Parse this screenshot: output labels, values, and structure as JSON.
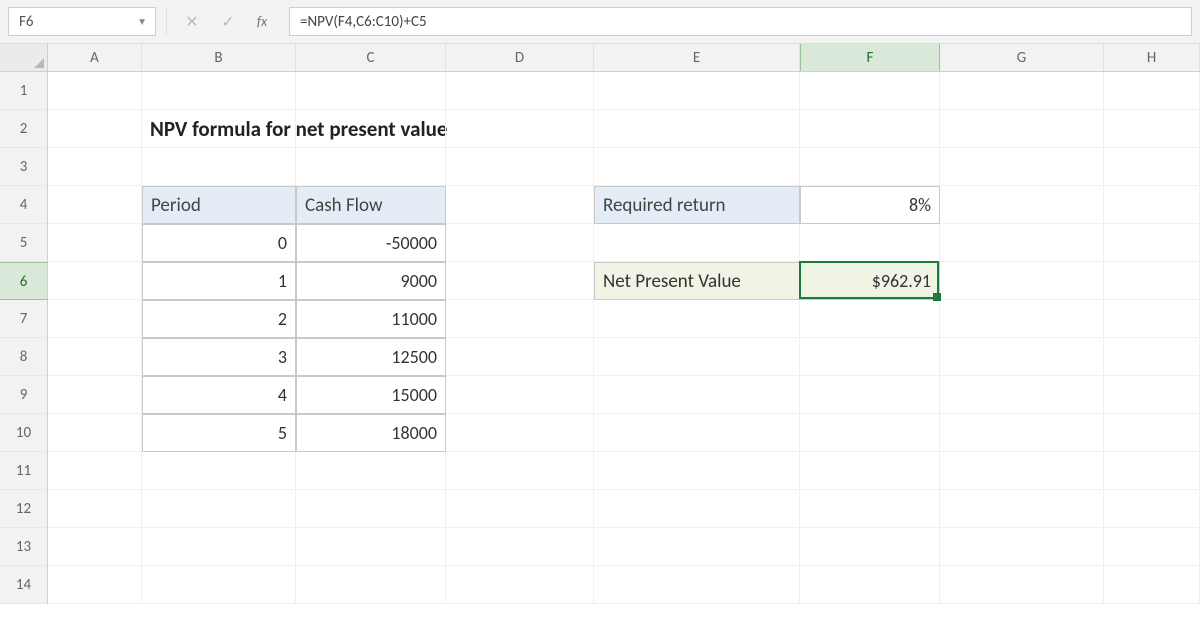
{
  "name_box": "F6",
  "formula": "=NPV(F4,C6:C10)+C5",
  "columns": [
    "A",
    "B",
    "C",
    "D",
    "E",
    "F",
    "G",
    "H"
  ],
  "rowCount": 14,
  "activeCol": "F",
  "activeRow": 6,
  "title": "NPV formula for net present value",
  "table": {
    "headers": {
      "period": "Period",
      "cashflow": "Cash Flow"
    },
    "rows": [
      {
        "period": "0",
        "cash": "-50000"
      },
      {
        "period": "1",
        "cash": "9000"
      },
      {
        "period": "2",
        "cash": "11000"
      },
      {
        "period": "3",
        "cash": "12500"
      },
      {
        "period": "4",
        "cash": "15000"
      },
      {
        "period": "5",
        "cash": "18000"
      }
    ]
  },
  "inputs": {
    "required_return_label": "Required return",
    "required_return_value": "8%",
    "npv_label": "Net Present Value",
    "npv_value": "$962.91"
  }
}
